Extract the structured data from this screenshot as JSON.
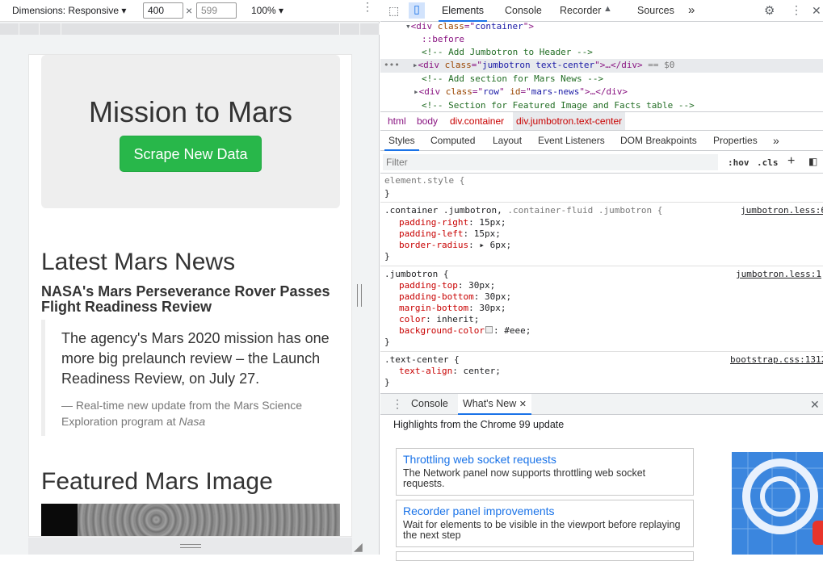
{
  "device_toolbar": {
    "dimensions_label": "Dimensions: Responsive ▾",
    "width_value": "400",
    "height_value": "599",
    "times": "×",
    "zoom_label": "100% ▾"
  },
  "page": {
    "jumbotron_title": "Mission to Mars",
    "scrape_button": "Scrape New Data",
    "news_heading": "Latest Mars News",
    "news_title": "NASA's Mars Perseverance Rover Passes Flight Readiness Review",
    "news_paragraph": "The agency's Mars 2020 mission has one more big prelaunch review – the Launch Readiness Review, on July 27.",
    "news_footer_prefix": "— Real-time new update from the Mars Science Exploration program at ",
    "news_footer_source": "Nasa",
    "featured_heading": "Featured Mars Image"
  },
  "devtools": {
    "tabs": [
      "Elements",
      "Console",
      "Recorder",
      "Sources"
    ],
    "more_tabs": "»",
    "dom": {
      "l1_tag_open": "<div ",
      "l1_attr": "class",
      "l1_eq": "=\"",
      "l1_val": "container",
      "l1_close": "\">",
      "l2": "::before",
      "l3": "<!-- Add Jumbotron to Header -->",
      "l4_open": "<div ",
      "l4_attr": "class",
      "l4_val": "jumbotron text-center",
      "l4_rest": "\">…</div>",
      "l4_eq": " == $0",
      "l5": "<!-- Add section for Mars News -->",
      "l6_open": "<div ",
      "l6_attr1": "class",
      "l6_val1": "row",
      "l6_attr2": "id",
      "l6_val2": "mars-news",
      "l6_rest": "\">…</div>",
      "l7": "<!-- Section for Featured Image and Facts table -->"
    },
    "breadcrumbs": [
      "html",
      "body",
      "div.container",
      "div.jumbotron.text-center"
    ],
    "style_tabs": [
      "Styles",
      "Computed",
      "Layout",
      "Event Listeners",
      "DOM Breakpoints",
      "Properties"
    ],
    "filter_placeholder": "Filter",
    "hov": ":hov",
    "cls": ".cls",
    "rules": {
      "element_style": "element.style {",
      "close": "}",
      "r1_sel_a": ".container .jumbotron, ",
      "r1_sel_b": ".container-fluid .jumbotron {",
      "r1_src": "jumbotron.less:6",
      "r1_p1": "padding-right",
      "r1_v1": ": 15px;",
      "r1_p2": "padding-left",
      "r1_v2": ": 15px;",
      "r1_p3": "border-radius",
      "r1_v3": ": ▸ 6px;",
      "r2_sel": ".jumbotron {",
      "r2_src": "jumbotron.less:1",
      "r2_p1": "padding-top",
      "r2_v1": ": 30px;",
      "r2_p2": "padding-bottom",
      "r2_v2": ": 30px;",
      "r2_p3": "margin-bottom",
      "r2_v3": ": 30px;",
      "r2_p4": "color",
      "r2_v4": ": inherit;",
      "r2_p5": "background-color",
      "r2_v5": ": #eee;",
      "r3_sel": ".text-center {",
      "r3_src": "bootstrap.css:1312",
      "r3_p1": "text-align",
      "r3_v1": ": center;"
    },
    "drawer": {
      "tab_console": "Console",
      "tab_whats_new": "What's New",
      "highlights": "Highlights from the Chrome 99 update",
      "cards": [
        {
          "title": "Throttling web socket requests",
          "desc": "The Network panel now supports throttling web socket requests."
        },
        {
          "title": "Recorder panel improvements",
          "desc": "Wait for elements to be visible in the viewport before replaying the next step"
        }
      ]
    }
  }
}
